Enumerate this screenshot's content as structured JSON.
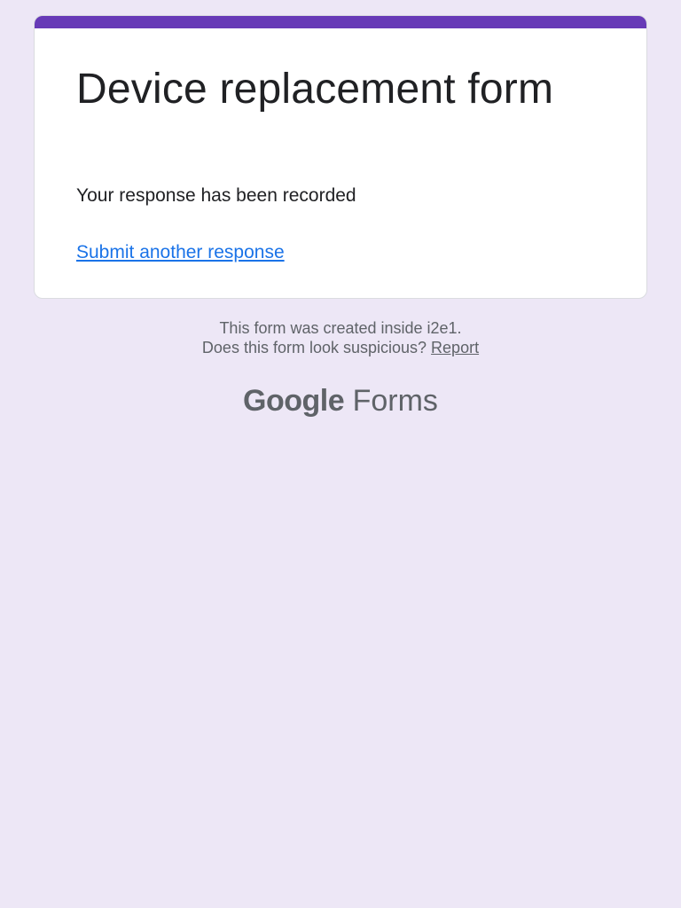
{
  "form": {
    "title": "Device replacement form",
    "confirmation_message": "Your response has been recorded",
    "submit_another_link": "Submit another response"
  },
  "footer": {
    "created_text": "This form was created inside i2e1.",
    "suspicious_text": "Does this form look suspicious?",
    "report_link": "Report"
  },
  "brand": {
    "google": "Google",
    "product": "Forms"
  },
  "colors": {
    "background": "#ede7f6",
    "accent": "#673ab7",
    "link": "#1a73e8"
  }
}
